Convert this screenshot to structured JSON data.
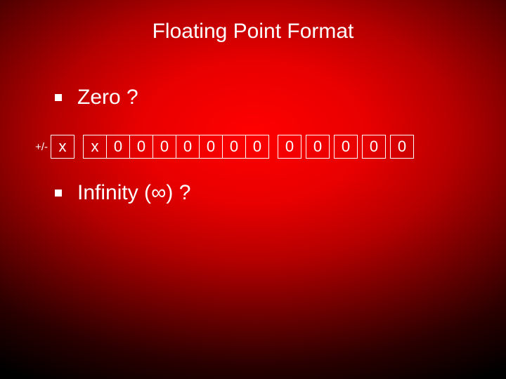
{
  "title": "Floating Point Format",
  "bullets": {
    "zero": "Zero ?",
    "infinity": "Infinity (∞) ?"
  },
  "bitrow": {
    "sign_label": "+/-",
    "cells": [
      "x",
      "x",
      "0",
      "0",
      "0",
      "0",
      "0",
      "0",
      "0",
      "0",
      "0",
      "0",
      "0",
      "0"
    ]
  }
}
